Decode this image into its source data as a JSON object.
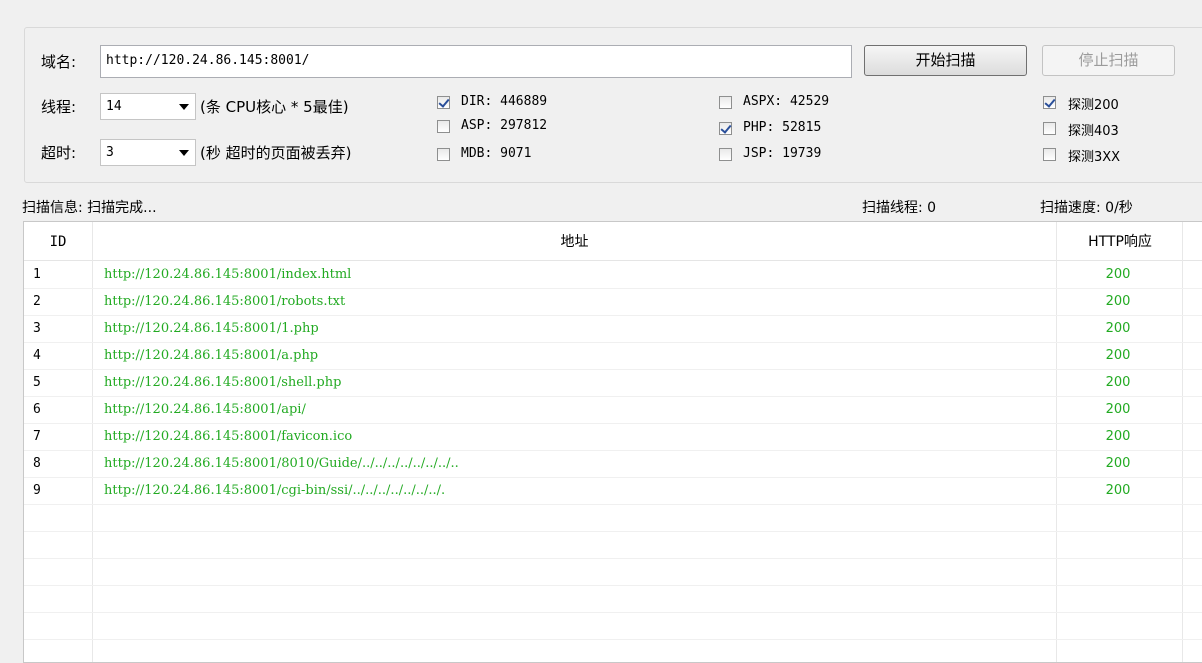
{
  "settings": {
    "domain_label": "域名:",
    "domain_value": "http://120.24.86.145:8001/",
    "start_button": "开始扫描",
    "stop_button": "停止扫描",
    "threads_label": "线程:",
    "threads_value": "14",
    "threads_hint": "(条 CPU核心 * 5最佳)",
    "timeout_label": "超时:",
    "timeout_value": "3",
    "timeout_hint": "(秒 超时的页面被丢弃)",
    "dicts": [
      {
        "label": "DIR: 446889",
        "checked": true
      },
      {
        "label": "ASP: 297812",
        "checked": false
      },
      {
        "label": "MDB: 9071",
        "checked": false
      },
      {
        "label": "ASPX: 42529",
        "checked": false
      },
      {
        "label": "PHP: 52815",
        "checked": true
      },
      {
        "label": "JSP: 19739",
        "checked": false
      }
    ],
    "probes": [
      {
        "label": "探测200",
        "checked": true
      },
      {
        "label": "探测403",
        "checked": false
      },
      {
        "label": "探测3XX",
        "checked": false
      }
    ]
  },
  "status": {
    "info": "扫描信息: 扫描完成...",
    "threads": "扫描线程: 0",
    "speed": "扫描速度: 0/秒"
  },
  "table": {
    "columns": [
      "ID",
      "地址",
      "HTTP响应"
    ],
    "rows": [
      {
        "id": "1",
        "url": "http://120.24.86.145:8001/index.html",
        "code": "200"
      },
      {
        "id": "2",
        "url": "http://120.24.86.145:8001/robots.txt",
        "code": "200"
      },
      {
        "id": "3",
        "url": "http://120.24.86.145:8001/1.php",
        "code": "200"
      },
      {
        "id": "4",
        "url": "http://120.24.86.145:8001/a.php",
        "code": "200"
      },
      {
        "id": "5",
        "url": "http://120.24.86.145:8001/shell.php",
        "code": "200"
      },
      {
        "id": "6",
        "url": "http://120.24.86.145:8001/api/",
        "code": "200"
      },
      {
        "id": "7",
        "url": "http://120.24.86.145:8001/favicon.ico",
        "code": "200"
      },
      {
        "id": "8",
        "url": "http://120.24.86.145:8001/8010/Guide/../../../../../../../..",
        "code": "200"
      },
      {
        "id": "9",
        "url": "http://120.24.86.145:8001/cgi-bin/ssi/../../../../../../../.",
        "code": "200"
      }
    ]
  },
  "colors": {
    "url_text": "#22aa22",
    "code_text": "#22aa22"
  }
}
